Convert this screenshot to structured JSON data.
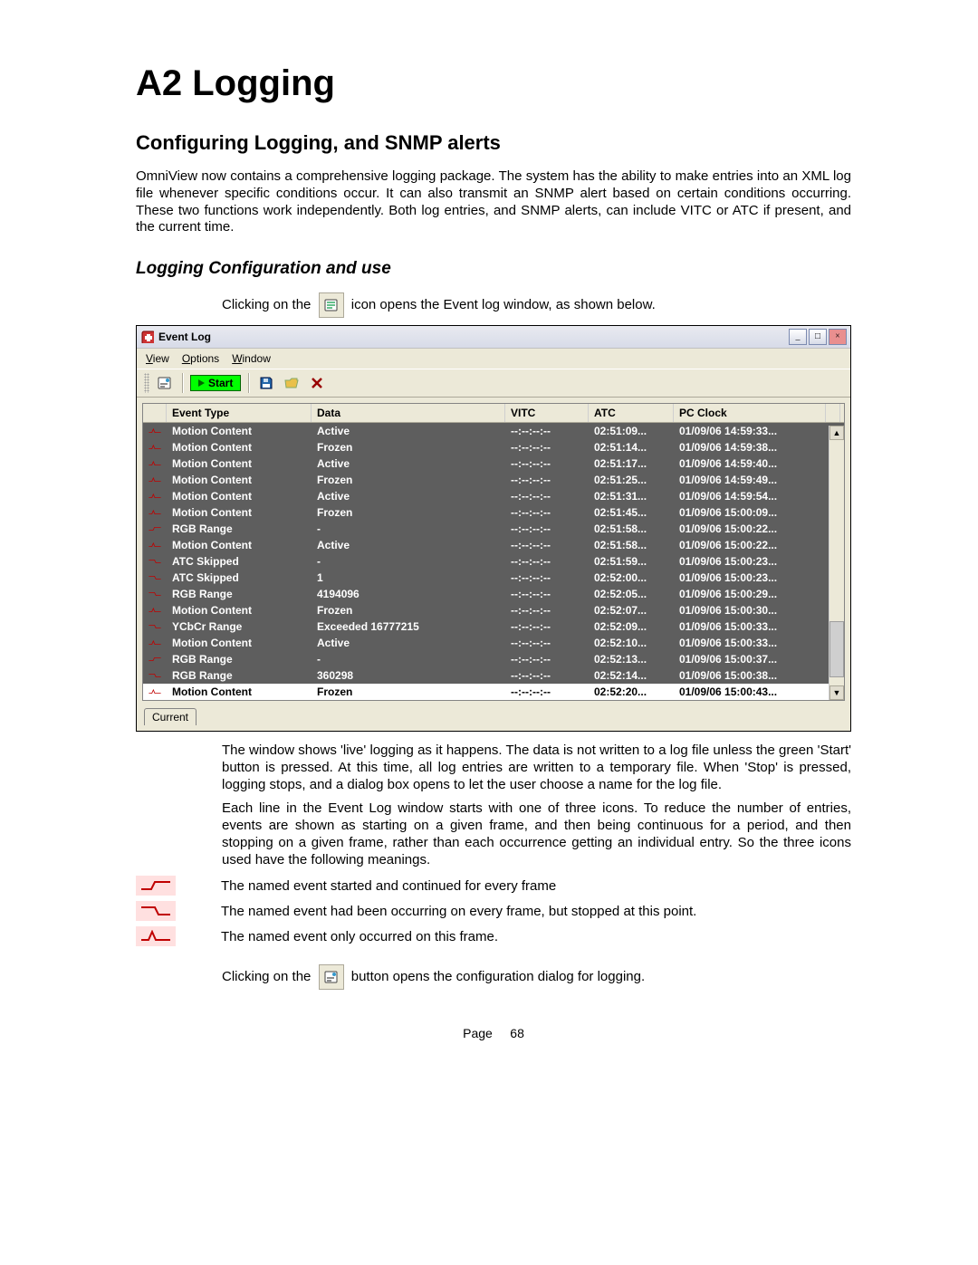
{
  "headings": {
    "h1": "A2 Logging",
    "h2": "Configuring Logging, and SNMP alerts",
    "h3": "Logging Configuration and use"
  },
  "paragraphs": {
    "intro": "OmniView now contains a comprehensive logging package.  The system has the ability to make entries into an XML log file whenever specific conditions occur.  It can also transmit an SNMP alert based on certain conditions occurring.  These two functions work independently.  Both log entries, and SNMP alerts, can include VITC or ATC if present, and the current time.",
    "icon_line_pre": "Clicking on the",
    "icon_line_post": "icon opens the Event log window, as shown below.",
    "after_grid_1": "The window shows 'live' logging as it happens.  The data is not written to a log file unless the green 'Start' button is pressed.  At this time, all log entries are written to a temporary file.  When 'Stop' is pressed, logging stops, and a dialog box opens to let the user choose a name for the log file.",
    "after_grid_2": "Each line in the Event Log window starts with one of three icons.  To reduce the number of entries, events are shown as starting on a given frame, and then being continuous for a period, and then stopping on a given frame, rather than each occurrence getting an individual entry.  So the three icons used have the following meanings.",
    "legend_rise": "The named event started and continued for every frame",
    "legend_fall": "The named event had been occurring on every frame, but stopped at this point.",
    "legend_pulse": "The named event only occurred on this frame.",
    "config_pre": "Clicking on the",
    "config_post": "button opens the configuration dialog for logging."
  },
  "eventlog": {
    "title": "Event Log",
    "menus": [
      {
        "label": "View",
        "accel": "V"
      },
      {
        "label": "Options",
        "accel": "O"
      },
      {
        "label": "Window",
        "accel": "W"
      }
    ],
    "toolbar": {
      "start": "Start"
    },
    "columns": {
      "type": "Event Type",
      "data": "Data",
      "vitc": "VITC",
      "atc": "ATC",
      "pc": "PC Clock"
    },
    "tab": "Current",
    "rows": [
      {
        "icon": "pulse",
        "type": "Motion Content",
        "data": "Active",
        "vitc": "--:--:--:--",
        "atc": "02:51:09...",
        "pc": "01/09/06 14:59:33..."
      },
      {
        "icon": "pulse",
        "type": "Motion Content",
        "data": "Frozen",
        "vitc": "--:--:--:--",
        "atc": "02:51:14...",
        "pc": "01/09/06 14:59:38..."
      },
      {
        "icon": "pulse",
        "type": "Motion Content",
        "data": "Active",
        "vitc": "--:--:--:--",
        "atc": "02:51:17...",
        "pc": "01/09/06 14:59:40..."
      },
      {
        "icon": "pulse",
        "type": "Motion Content",
        "data": "Frozen",
        "vitc": "--:--:--:--",
        "atc": "02:51:25...",
        "pc": "01/09/06 14:59:49..."
      },
      {
        "icon": "pulse",
        "type": "Motion Content",
        "data": "Active",
        "vitc": "--:--:--:--",
        "atc": "02:51:31...",
        "pc": "01/09/06 14:59:54..."
      },
      {
        "icon": "pulse",
        "type": "Motion Content",
        "data": "Frozen",
        "vitc": "--:--:--:--",
        "atc": "02:51:45...",
        "pc": "01/09/06 15:00:09..."
      },
      {
        "icon": "rise",
        "type": "RGB Range",
        "data": "-",
        "vitc": "--:--:--:--",
        "atc": "02:51:58...",
        "pc": "01/09/06 15:00:22..."
      },
      {
        "icon": "pulse",
        "type": "Motion Content",
        "data": "Active",
        "vitc": "--:--:--:--",
        "atc": "02:51:58...",
        "pc": "01/09/06 15:00:22..."
      },
      {
        "icon": "fall",
        "type": "ATC Skipped",
        "data": "-",
        "vitc": "--:--:--:--",
        "atc": "02:51:59...",
        "pc": "01/09/06 15:00:23..."
      },
      {
        "icon": "fall",
        "type": "ATC Skipped",
        "data": "1",
        "vitc": "--:--:--:--",
        "atc": "02:52:00...",
        "pc": "01/09/06 15:00:23..."
      },
      {
        "icon": "fall",
        "type": "RGB Range",
        "data": "4194096",
        "vitc": "--:--:--:--",
        "atc": "02:52:05...",
        "pc": "01/09/06 15:00:29..."
      },
      {
        "icon": "pulse",
        "type": "Motion Content",
        "data": "Frozen",
        "vitc": "--:--:--:--",
        "atc": "02:52:07...",
        "pc": "01/09/06 15:00:30..."
      },
      {
        "icon": "fall",
        "type": "YCbCr Range",
        "data": "Exceeded 16777215",
        "vitc": "--:--:--:--",
        "atc": "02:52:09...",
        "pc": "01/09/06 15:00:33..."
      },
      {
        "icon": "pulse",
        "type": "Motion Content",
        "data": "Active",
        "vitc": "--:--:--:--",
        "atc": "02:52:10...",
        "pc": "01/09/06 15:00:33..."
      },
      {
        "icon": "rise",
        "type": "RGB Range",
        "data": "-",
        "vitc": "--:--:--:--",
        "atc": "02:52:13...",
        "pc": "01/09/06 15:00:37..."
      },
      {
        "icon": "fall",
        "type": "RGB Range",
        "data": "360298",
        "vitc": "--:--:--:--",
        "atc": "02:52:14...",
        "pc": "01/09/06 15:00:38..."
      },
      {
        "icon": "pulse",
        "type": "Motion Content",
        "data": "Frozen",
        "vitc": "--:--:--:--",
        "atc": "02:52:20...",
        "pc": "01/09/06 15:00:43...",
        "selected": true
      }
    ]
  },
  "footer": {
    "page_word": "Page",
    "page_num": "68"
  }
}
